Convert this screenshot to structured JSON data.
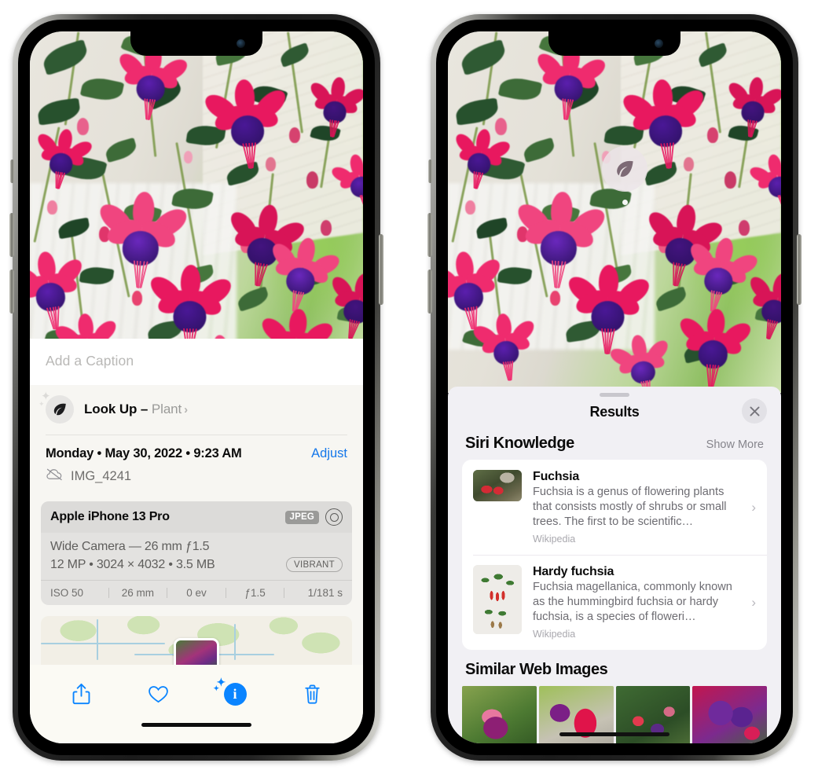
{
  "left_phone": {
    "caption_placeholder": "Add a Caption",
    "lookup": {
      "label": "Look Up –",
      "subject": "Plant",
      "icon": "leaf-icon",
      "chevron": "›"
    },
    "meta": {
      "date": "Monday • May 30, 2022 • 9:23 AM",
      "adjust_label": "Adjust",
      "filename": "IMG_4241",
      "cloud_icon": "icloud-slash-icon"
    },
    "camera_card": {
      "device": "Apple iPhone 13 Pro",
      "format_badge": "JPEG",
      "lens_icon": "lens-icon",
      "line1": "Wide Camera — 26 mm ƒ1.5",
      "line2": "12 MP • 3024 × 4032 • 3.5 MB",
      "style_badge": "VIBRANT",
      "exif": [
        "ISO 50",
        "26 mm",
        "0 ev",
        "ƒ1.5",
        "1/181 s"
      ]
    },
    "toolbar": [
      {
        "name": "share-button",
        "icon": "share-icon"
      },
      {
        "name": "favorite-button",
        "icon": "heart-icon"
      },
      {
        "name": "info-button",
        "icon": "info-sparkle-icon"
      },
      {
        "name": "delete-button",
        "icon": "trash-icon"
      }
    ]
  },
  "right_phone": {
    "visual_lookup_badge": {
      "icon": "leaf-icon"
    },
    "sheet_title": "Results",
    "close_icon": "close-icon",
    "siri_knowledge": {
      "heading": "Siri Knowledge",
      "show_more": "Show More",
      "results": [
        {
          "title": "Fuchsia",
          "description": "Fuchsia is a genus of flowering plants that consists mostly of shrubs or small trees. The first to be scientific…",
          "source": "Wikipedia",
          "chevron": "›"
        },
        {
          "title": "Hardy fuchsia",
          "description": "Fuchsia magellanica, commonly known as the hummingbird fuchsia or hardy fuchsia, is a species of floweri…",
          "source": "Wikipedia",
          "chevron": "›"
        }
      ]
    },
    "similar_web_images": {
      "heading": "Similar Web Images",
      "count": 4
    }
  },
  "colors": {
    "accent_blue": "#0a84ff",
    "link_blue": "#1477ea",
    "sheet_bg_left": "#f7f6f2",
    "sheet_bg_right": "#f1f0f4",
    "card_bg": "#ffffff"
  }
}
